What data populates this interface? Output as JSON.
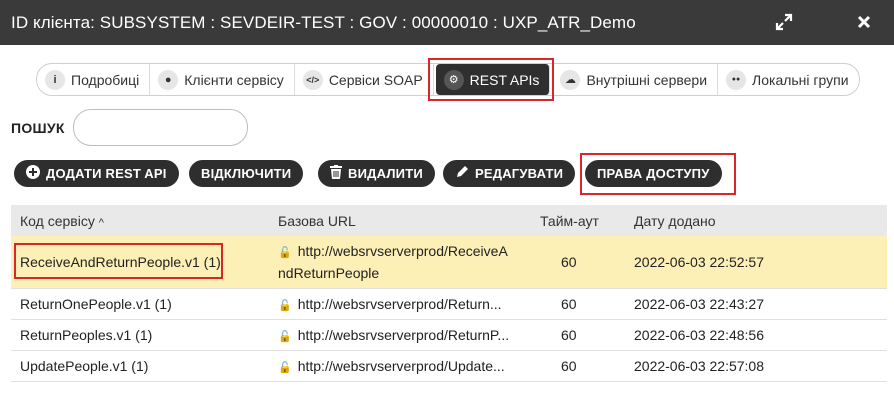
{
  "window": {
    "title": "ID клієнта: SUBSYSTEM : SEVDEIR-TEST : GOV : 00000010 : UXP_ATR_Demo"
  },
  "tabs": [
    {
      "label": "Подробиці",
      "icon": "info-icon",
      "glyph": "i"
    },
    {
      "label": "Клієнти сервісу",
      "icon": "user-icon",
      "glyph": "●"
    },
    {
      "label": "Сервіси SOAP",
      "icon": "code-icon",
      "glyph": "</>"
    },
    {
      "label": "REST APIs",
      "icon": "cogs-icon",
      "glyph": "⚙",
      "active": true
    },
    {
      "label": "Внутрішні сервери",
      "icon": "cloud-icon",
      "glyph": "☁"
    },
    {
      "label": "Локальні групи",
      "icon": "users-icon",
      "glyph": "●●"
    }
  ],
  "search": {
    "label": "ПОШУК",
    "value": ""
  },
  "toolbar": {
    "add_label": "ДОДАТИ REST API",
    "disable_label": "ВІДКЛЮЧИТИ",
    "delete_label": "ВИДАЛИТИ",
    "edit_label": "РЕДАГУВАТИ",
    "access_label": "ПРАВА ДОСТУПУ"
  },
  "table": {
    "headers": {
      "code": "Код сервісу",
      "sort_indicator": "^",
      "url": "Базова URL",
      "timeout": "Тайм-аут",
      "date": "Дату додано"
    },
    "rows": [
      {
        "code": "ReceiveAndReturnPeople.v1 (1)",
        "url": "http://websrvserverprod/ReceiveAndReturnPeople",
        "url_line1": "http://websrvserverprod/ReceiveA",
        "url_line2": "ndReturnPeople",
        "timeout": "60",
        "date": "2022-06-03 22:52:57"
      },
      {
        "code": "ReturnOnePeople.v1 (1)",
        "url": "http://websrvserverprod/Return...",
        "timeout": "60",
        "date": "2022-06-03 22:43:27"
      },
      {
        "code": "ReturnPeoples.v1 (1)",
        "url": "http://websrvserverprod/ReturnP...",
        "timeout": "60",
        "date": "2022-06-03 22:48:56"
      },
      {
        "code": "UpdatePeople.v1 (1)",
        "url": "http://websrvserverprod/Update...",
        "timeout": "60",
        "date": "2022-06-03 22:57:08"
      }
    ]
  },
  "colors": {
    "titlebar": "#3a3a3a",
    "highlight_row": "#fdf0b6",
    "annotation_red": "#d9262c",
    "button_dark": "#2e2e2e"
  }
}
